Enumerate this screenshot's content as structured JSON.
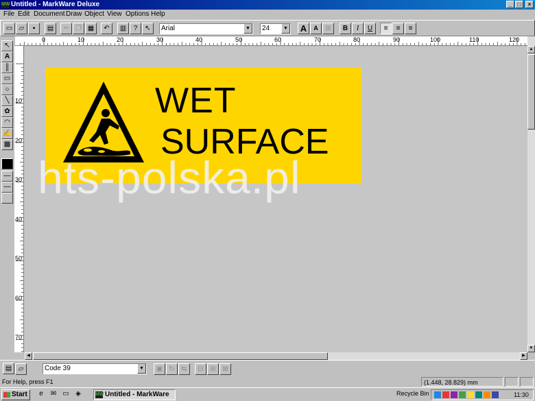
{
  "window": {
    "title": "Untitled - MarkWare Deluxe",
    "app_icon": "MW",
    "minimize": "_",
    "maximize": "□",
    "close": "×"
  },
  "menu": {
    "file": "File",
    "edit": "Edit",
    "document": "Document",
    "draw": "Draw",
    "object": "Object",
    "view": "View",
    "options": "Options",
    "help": "Help"
  },
  "toolbar": {
    "font": "Arial",
    "size": "24",
    "bold": "B",
    "italic": "I",
    "underline": "U",
    "grow_font": "A",
    "shrink_font": "A",
    "help_q": "?"
  },
  "ruler": {
    "h_labels": [
      "0",
      "10",
      "20",
      "30",
      "40",
      "50",
      "60",
      "70",
      "80",
      "90",
      "100",
      "110",
      "120"
    ],
    "v_labels": [
      "10",
      "20",
      "30",
      "40",
      "50",
      "60",
      "70"
    ]
  },
  "sign": {
    "line1": "WET",
    "line2": "SURFACE",
    "background_color": "#ffd500"
  },
  "watermark": "hts-polska.pl",
  "bottom_toolbar": {
    "barcode_type": "Code 39"
  },
  "status": {
    "help": "For Help, press F1",
    "coordinates": "(1.448, 28.829) mm"
  },
  "taskbar": {
    "start": "Start",
    "task_label": "Untitled - MarkWare ...",
    "recycle_bin": "Recycle Bin",
    "clock": "11:30"
  },
  "icons": {
    "palette": [
      "pointer-icon",
      "text-icon",
      "barcode-icon",
      "rectangle-icon",
      "ellipse-icon",
      "line-icon",
      "graphic-icon",
      "arc-icon",
      "signature-icon",
      "matrix-icon"
    ],
    "toolbar": [
      "new-icon",
      "open-icon",
      "save-icon",
      "import-icon",
      "cut-icon",
      "copy-icon",
      "paste-icon",
      "undo-icon",
      "print-icon",
      "help-icon",
      "context-help-icon"
    ]
  }
}
